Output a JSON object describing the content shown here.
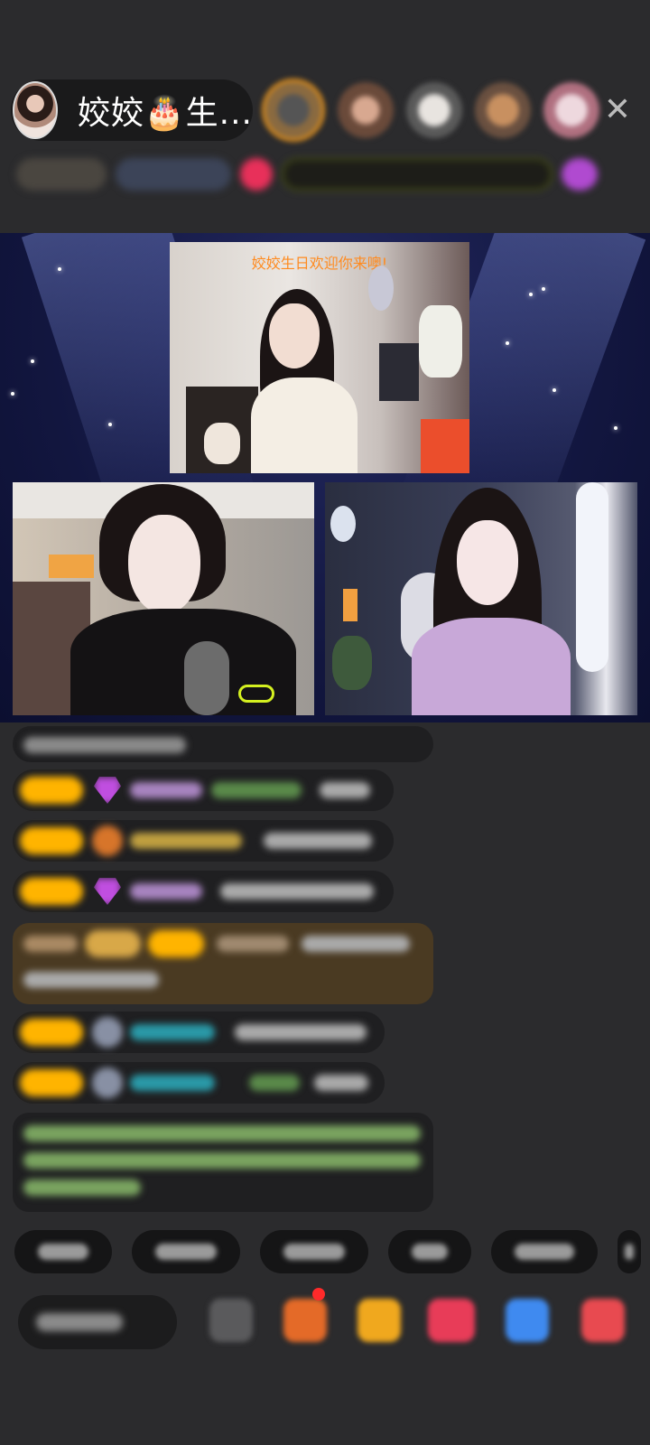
{
  "header": {
    "host_name": "姣姣🎂生...",
    "close_glyph": "✕",
    "viewer_avatars": [
      "viewer-1",
      "viewer-2",
      "viewer-3",
      "viewer-4",
      "viewer-5"
    ]
  },
  "stage": {
    "top_cam_caption": "姣姣生日欢迎你来噢!"
  },
  "colors": {
    "background": "#2b2b2d",
    "stage_background": "#12163f",
    "caption": "#ff8a1e",
    "level_badge": "#ffb400",
    "gold_ring": "#d4891e"
  },
  "icons": [
    "close-icon",
    "diamond-icon",
    "gift-icon",
    "emoji-icon",
    "more-icon"
  ]
}
